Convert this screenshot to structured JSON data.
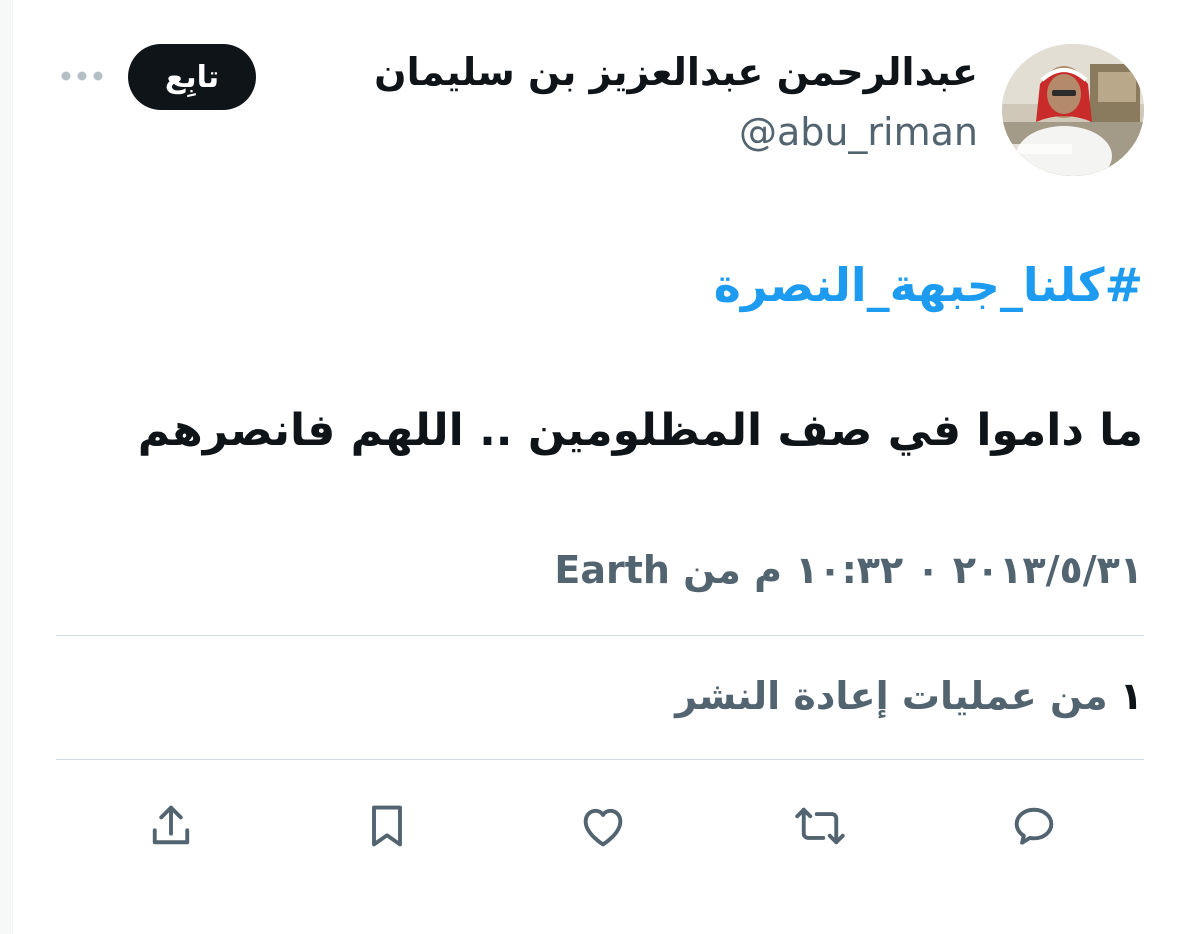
{
  "user": {
    "display_name": "عبدالرحمن عبدالعزيز بن سليمان",
    "handle": "@abu_riman"
  },
  "follow_button_label": "تابِع",
  "more_icon": "more-horizontal-icon",
  "tweet": {
    "hashtag": "#كلنا_جبهة_النصرة",
    "text": "ما داموا في صف المظلومين .. اللهم فانصرهم",
    "timestamp": "٢٠١٣/٥/٣١ ٠ ١٠:٣٢ م من",
    "place": "Earth"
  },
  "engagement": {
    "retweet_count": "١",
    "retweet_label": "من عمليات إعادة النشر"
  },
  "actions": {
    "reply_icon": "reply-icon",
    "retweet_icon": "retweet-icon",
    "like_icon": "heart-icon",
    "bookmark_icon": "bookmark-icon",
    "share_icon": "share-icon"
  },
  "colors": {
    "text": "#0f1419",
    "secondary": "#536471",
    "hashtag": "#1d9bf0",
    "divider": "#cfd9de"
  }
}
